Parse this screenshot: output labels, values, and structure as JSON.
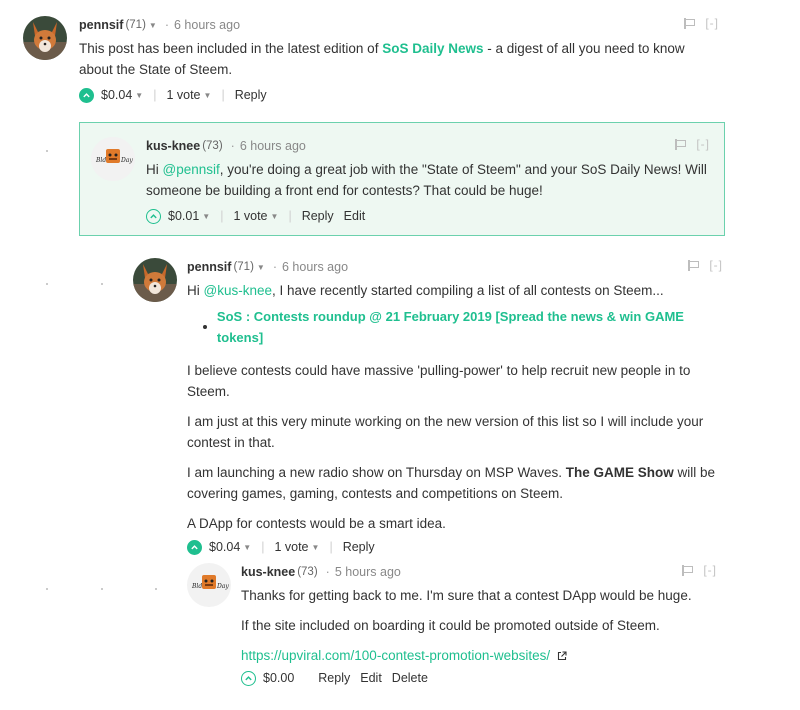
{
  "colors": {
    "accent": "#1fbf8f",
    "highlight_bg": "#eef8f2",
    "highlight_border": "#6bd1ad"
  },
  "comments": [
    {
      "author": "pennsif",
      "rep": "(71)",
      "time": "6 hours ago",
      "collapse": "[-]",
      "text_before": "This post has been included in the latest edition of ",
      "link": "SoS Daily News",
      "text_after": " - a digest of all you need to know about the State of Steem.",
      "payout": "$0.04",
      "votes": "1 vote",
      "reply": "Reply"
    },
    {
      "author": "kus-knee",
      "rep": "(73)",
      "time": "6 hours ago",
      "collapse": "[-]",
      "text_before": "Hi ",
      "mention": "@pennsif",
      "text_after": ", you're doing a great job with the \"State of Steem\" and your SoS Daily News! Will someone be building a front end for contests? That could be huge!",
      "payout": "$0.01",
      "votes": "1 vote",
      "reply": "Reply",
      "edit": "Edit"
    },
    {
      "author": "pennsif",
      "rep": "(71)",
      "time": "6 hours ago",
      "collapse": "[-]",
      "text_before": "Hi ",
      "mention": "@kus-knee",
      "text_after": ", I have recently started compiling a list of all contests on Steem...",
      "bullet_link": "SoS : Contests roundup @ 21 February 2019 [Spread the news & win GAME tokens]",
      "p1": "I believe contests could have massive 'pulling-power' to help recruit new people in to Steem.",
      "p2": "I am just at this very minute working on the new version of this list so I will include your contest in that.",
      "p3_before": "I am launching a new radio show on Thursday on MSP Waves. ",
      "p3_bold": "The GAME Show",
      "p3_after": " will be covering games, gaming, contests and competitions on Steem.",
      "p4": "A DApp for contests would be a smart idea.",
      "payout": "$0.04",
      "votes": "1 vote",
      "reply": "Reply"
    },
    {
      "author": "kus-knee",
      "rep": "(73)",
      "time": "5 hours ago",
      "collapse": "[-]",
      "p1": "Thanks for getting back to me. I'm sure that a contest DApp would be huge.",
      "p2": "If the site included on boarding it could be promoted outside of Steem.",
      "url": "https://upviral.com/100-contest-promotion-websites/",
      "payout": "$0.00",
      "reply": "Reply",
      "edit": "Edit",
      "delete": "Delete"
    }
  ]
}
